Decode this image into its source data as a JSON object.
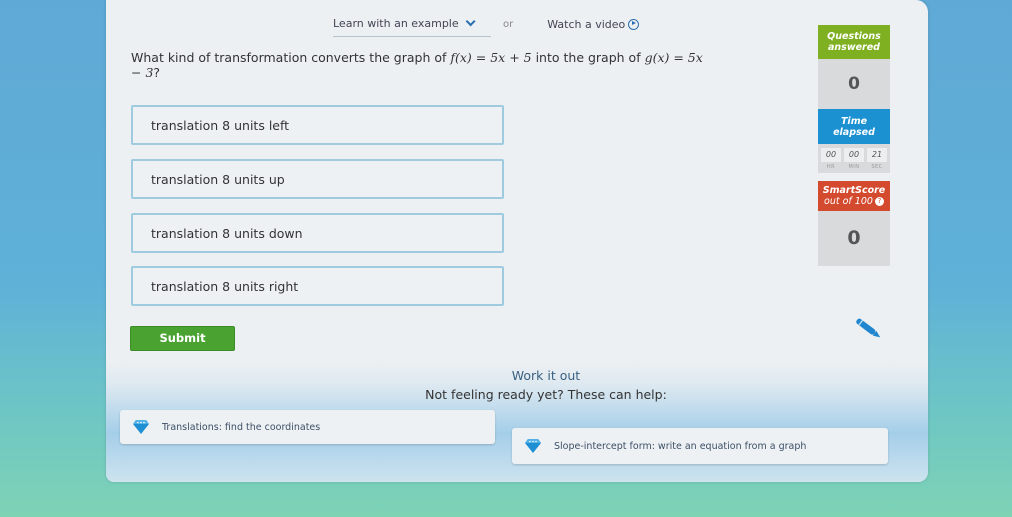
{
  "top_links": {
    "learn_example": "Learn with an example",
    "or": "or",
    "watch_video": "Watch a video"
  },
  "question": {
    "prefix": "What kind of transformation converts the graph of ",
    "f_expr": "f(x) = 5x + 5",
    "middle": " into the graph of ",
    "g_expr": "g(x) = 5x − 3",
    "suffix": "?"
  },
  "choices": [
    {
      "label": "translation 8 units left"
    },
    {
      "label": "translation 8 units up"
    },
    {
      "label": "translation 8 units down"
    },
    {
      "label": "translation 8 units right"
    }
  ],
  "submit_label": "Submit",
  "stats": {
    "questions_answered_label_1": "Questions",
    "questions_answered_label_2": "answered",
    "questions_answered_value": "0",
    "time_elapsed_label_1": "Time",
    "time_elapsed_label_2": "elapsed",
    "timer": {
      "hr": "00",
      "min": "00",
      "sec": "21",
      "hr_label": "HR",
      "min_label": "MIN",
      "sec_label": "SEC"
    },
    "smartscore_label": "SmartScore",
    "smartscore_sub": "out of 100",
    "smartscore_help": "?",
    "smartscore_value": "0"
  },
  "work_it_out": {
    "title": "Work it out",
    "subtitle": "Not feeling ready yet? These can help:",
    "links": [
      {
        "label": "Translations: find the coordinates",
        "icon": "diamond-icon"
      },
      {
        "label": "Slope-intercept form: write an equation from a graph",
        "icon": "diamond-icon"
      }
    ]
  },
  "colors": {
    "green": "#7fb021",
    "blue": "#1b91d1",
    "red": "#d34a2f",
    "submit": "#4aa331",
    "choice_border": "#9fcbe0"
  }
}
